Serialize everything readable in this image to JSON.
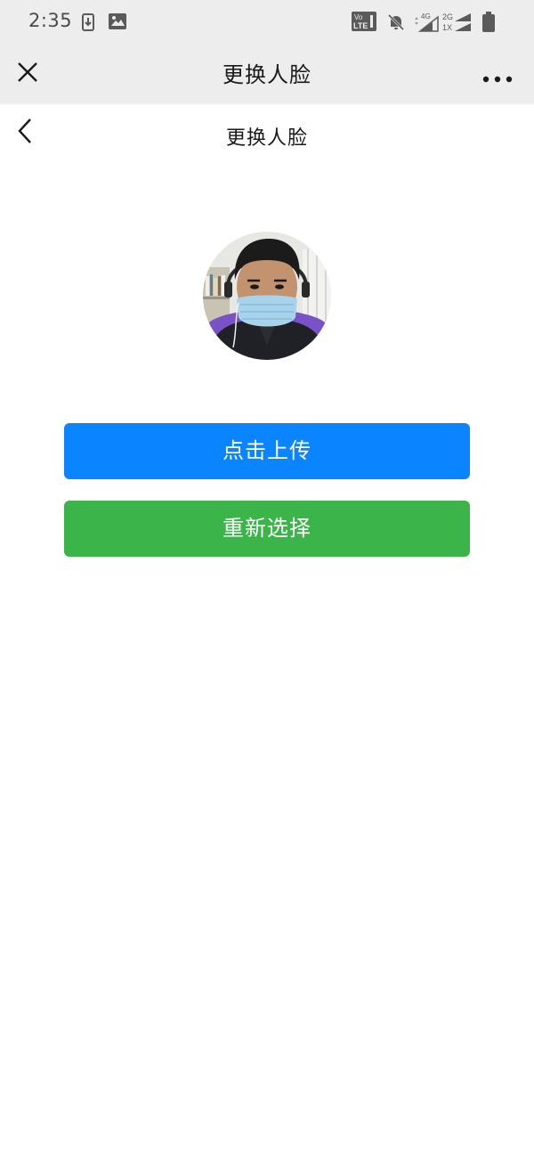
{
  "status_bar": {
    "time": "2:35",
    "icons": [
      "download-icon",
      "image-icon",
      "volte-icon",
      "mute-bell-icon",
      "signal-4g-icon",
      "signal-2g-icon",
      "battery-icon"
    ],
    "network_4g": "4G",
    "network_2g": "2G",
    "network_1x": "1X",
    "volte_top": "Vo",
    "volte_bottom": "LTE"
  },
  "wechat_bar": {
    "title": "更换人脸"
  },
  "page": {
    "title": "更换人脸"
  },
  "buttons": {
    "upload_label": "点击上传",
    "reselect_label": "重新选择"
  },
  "colors": {
    "upload_button": "#0a84ff",
    "reselect_button": "#3bb54a",
    "bar_background": "#ededed"
  }
}
